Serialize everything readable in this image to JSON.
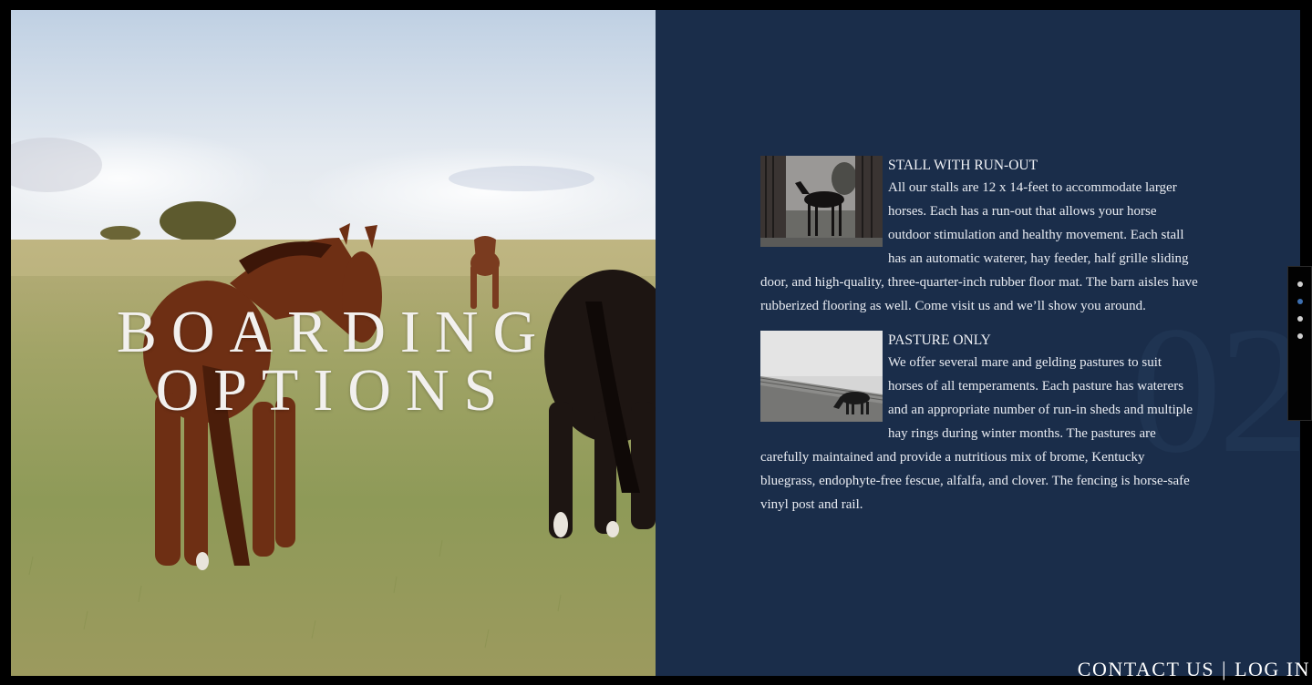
{
  "hero": {
    "title_line1": "BOARDING",
    "title_line2": "OPTIONS"
  },
  "section_number": "02",
  "sections": [
    {
      "heading": "STALL WITH RUN-OUT",
      "text": "All our stalls are 12 x 14-feet to accommodate larger horses. Each has a run-out that allows your horse outdoor stimulation and healthy movement. Each stall has an automatic waterer, hay feeder, half grille sliding door, and high-quality, three-quarter-inch rubber floor mat. The barn aisles have rubberized flooring as well. Come visit us and we’ll show you around."
    },
    {
      "heading": "PASTURE ONLY",
      "text": "We offer several mare and gelding pastures to suit horses of all temperaments. Each pasture has waterers and an appropriate number of run-in sheds and multiple hay rings during winter months. The pastures are carefully maintained and provide a nutritious mix of brome, Kentucky bluegrass, endophyte-free fescue, alfalfa, and clover. The fencing is horse-safe vinyl post and rail."
    }
  ],
  "dot_nav": {
    "count": 4,
    "active_index": 1
  },
  "footer": {
    "contact": "CONTACT US",
    "separator": "|",
    "login": "LOG IN"
  },
  "colors": {
    "navy_panel": "#1a2d4a",
    "active_dot": "#3d6fb0",
    "frame": "#000000"
  }
}
